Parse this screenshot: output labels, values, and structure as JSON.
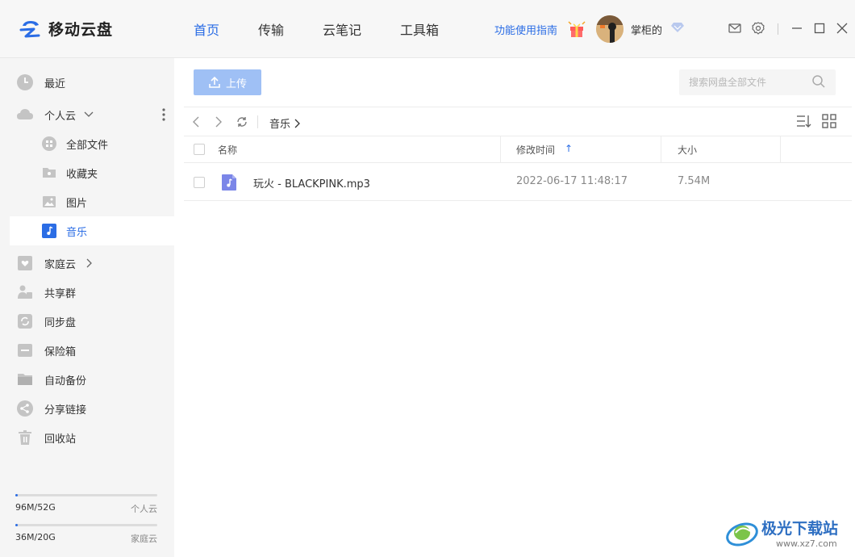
{
  "app": {
    "title": "移动云盘"
  },
  "nav": {
    "items": [
      "首页",
      "传输",
      "云笔记",
      "工具箱"
    ],
    "active": "首页"
  },
  "header": {
    "guide": "功能使用指南",
    "username": "掌柜的"
  },
  "sidebar": {
    "recent": "最近",
    "personal_cloud": "个人云",
    "all_files": "全部文件",
    "favorites": "收藏夹",
    "pictures": "图片",
    "music": "音乐",
    "family_cloud": "家庭云",
    "share_group": "共享群",
    "sync_disk": "同步盘",
    "safe_box": "保险箱",
    "auto_backup": "自动备份",
    "share_links": "分享链接",
    "recycle_bin": "回收站",
    "active": "音乐"
  },
  "quota": [
    {
      "used": "96M/52G",
      "name": "个人云",
      "fraction": 0.0018
    },
    {
      "used": "36M/20G",
      "name": "家庭云",
      "fraction": 0.0018
    }
  ],
  "toolbar": {
    "upload_label": "上传",
    "search_placeholder": "搜索网盘全部文件"
  },
  "breadcrumb": {
    "current": "音乐"
  },
  "table": {
    "headers": {
      "name": "名称",
      "modified": "修改时间",
      "size": "大小"
    },
    "sort_indicator": "↑",
    "rows": [
      {
        "name": "玩火 - BLACKPINK.mp3",
        "modified": "2022-06-17 11:48:17",
        "size": "7.54M"
      }
    ]
  },
  "colors": {
    "accent": "#2b6de5",
    "upload_btn": "#9fc0f5",
    "sidebar_bg": "#f5f5f5"
  },
  "watermark": {
    "text": "极光下载站",
    "url": "www.xz7.com"
  }
}
